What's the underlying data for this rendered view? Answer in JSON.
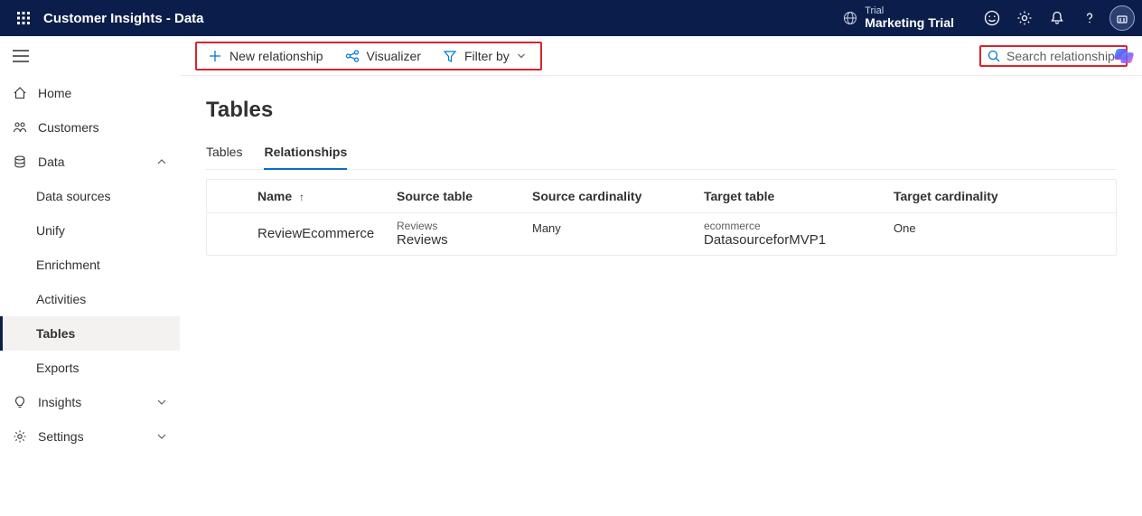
{
  "header": {
    "app_title": "Customer Insights - Data",
    "env_label": "Trial",
    "env_name": "Marketing Trial"
  },
  "sidebar": {
    "items": [
      {
        "label": "Home"
      },
      {
        "label": "Customers"
      },
      {
        "label": "Data",
        "expanded": true,
        "children": [
          {
            "label": "Data sources"
          },
          {
            "label": "Unify"
          },
          {
            "label": "Enrichment"
          },
          {
            "label": "Activities"
          },
          {
            "label": "Tables",
            "active": true
          },
          {
            "label": "Exports"
          }
        ]
      },
      {
        "label": "Insights"
      },
      {
        "label": "Settings"
      }
    ]
  },
  "toolbar": {
    "new_relationship": "New relationship",
    "visualizer": "Visualizer",
    "filter_by": "Filter by",
    "search_placeholder": "Search relationships"
  },
  "page": {
    "title": "Tables",
    "tabs": [
      {
        "label": "Tables",
        "active": false
      },
      {
        "label": "Relationships",
        "active": true
      }
    ]
  },
  "table": {
    "columns": {
      "name": "Name",
      "source_table": "Source table",
      "source_card": "Source cardinality",
      "target_table": "Target table",
      "target_card": "Target cardinality"
    },
    "sort_col": "name",
    "sort_dir": "asc",
    "rows": [
      {
        "name": "ReviewEcommerce",
        "source_table_small": "Reviews",
        "source_table": "Reviews",
        "source_card": "Many",
        "target_table_small": "ecommerce",
        "target_table": "DatasourceforMVP1",
        "target_card": "One"
      }
    ]
  }
}
